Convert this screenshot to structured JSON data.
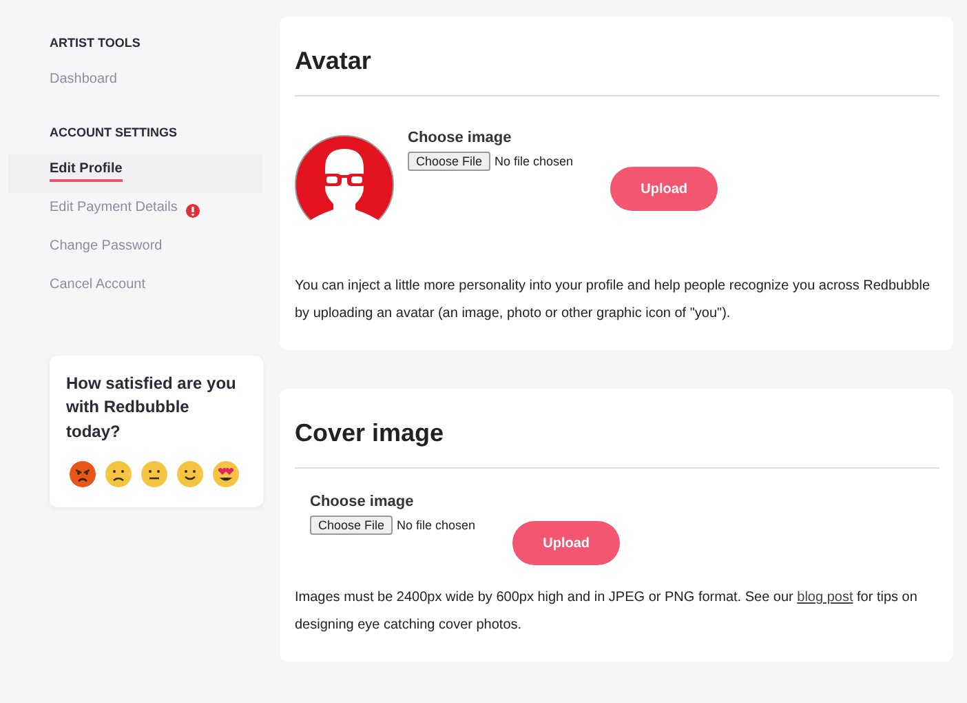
{
  "sidebar": {
    "sections": [
      {
        "heading": "ARTIST TOOLS",
        "items": [
          {
            "label": "Dashboard",
            "selected": false,
            "alert": false
          }
        ]
      },
      {
        "heading": "ACCOUNT SETTINGS",
        "items": [
          {
            "label": "Edit Profile",
            "selected": true,
            "alert": false
          },
          {
            "label": "Edit Payment Details",
            "selected": false,
            "alert": true
          },
          {
            "label": "Change Password",
            "selected": false,
            "alert": false
          },
          {
            "label": "Cancel Account",
            "selected": false,
            "alert": false
          }
        ]
      }
    ],
    "survey": {
      "question": "How satisfied are you with Redbubble today?",
      "faces": [
        {
          "kind": "angry"
        },
        {
          "kind": "sad"
        },
        {
          "kind": "neutral"
        },
        {
          "kind": "happy"
        },
        {
          "kind": "love"
        }
      ]
    }
  },
  "avatar_section": {
    "title": "Avatar",
    "label": "Choose image",
    "file_button": "Choose File",
    "file_status": "No file chosen",
    "upload": "Upload",
    "description": "You can inject a little more personality into your profile and help people recognize you across Redbubble by uploading an avatar (an image, photo or other graphic icon of \"you\")."
  },
  "cover_section": {
    "title": "Cover image",
    "label": "Choose image",
    "file_button": "Choose File",
    "file_status": "No file chosen",
    "upload": "Upload",
    "description_before": "Images must be 2400px wide by 600px high and in JPEG or PNG format. See our ",
    "link": "blog post",
    "description_after": " for tips on designing eye catching cover photos."
  }
}
